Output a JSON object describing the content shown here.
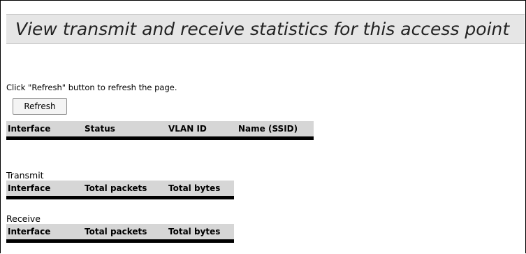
{
  "page": {
    "title": "View transmit and receive statistics for this access point",
    "hint": "Click \"Refresh\" button to refresh the page.",
    "refresh_label": "Refresh"
  },
  "interfaces_table": {
    "headers": [
      "Interface",
      "Status",
      "VLAN ID",
      "Name (SSID)"
    ],
    "rows": []
  },
  "transmit": {
    "label": "Transmit",
    "headers": [
      "Interface",
      "Total packets",
      "Total bytes"
    ],
    "rows": []
  },
  "receive": {
    "label": "Receive",
    "headers": [
      "Interface",
      "Total packets",
      "Total bytes"
    ],
    "rows": []
  },
  "colors": {
    "header_bg": "#e6e6e6",
    "table_header_bg": "#d6d6d6",
    "table_header_rule": "#000000"
  }
}
